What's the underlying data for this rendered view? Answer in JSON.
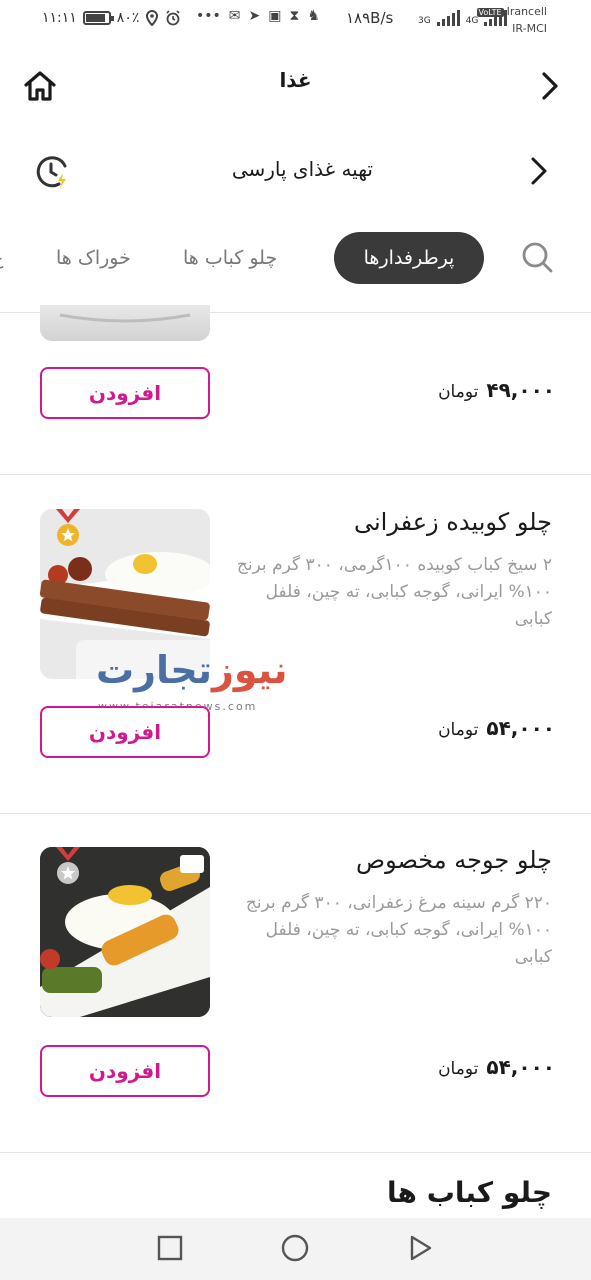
{
  "status_bar": {
    "time": "۱۱:۱۱",
    "battery": "۸۰٪",
    "network_speed": "۱۸۹B/s",
    "carrier_1": "Irancell",
    "carrier_2": "IR-MCI",
    "volte_label": "VoLTE",
    "net_3g": "3G",
    "net_4g": "4G"
  },
  "header": {
    "title": "غذا",
    "home_icon": "home-icon",
    "back_icon": "chevron-right-icon"
  },
  "restaurant": {
    "name": "تهیه غذای پارسی"
  },
  "tabs": [
    {
      "label": "پرطرفدارها",
      "active": true
    },
    {
      "label": "چلو کباب ها",
      "active": false
    },
    {
      "label": "خوراک ها",
      "active": false
    },
    {
      "label": "غ",
      "active": false
    }
  ],
  "products": [
    {
      "price": "۴۹,۰۰۰",
      "currency": "تومان",
      "add_label": "افزودن"
    },
    {
      "name": "چلو کوبیده زعفرانی",
      "description": "۲ سیخ کباب کوبیده ۱۰۰گرمی، ۳۰۰ گرم برنج ۱۰۰% ایرانی، گوجه کبابی، ته چین، فلفل کبابی",
      "price": "۵۴,۰۰۰",
      "currency": "تومان",
      "add_label": "افزودن"
    },
    {
      "name": "چلو جوجه مخصوص",
      "description": "۲۲۰ گرم سینه مرغ زعفرانی، ۳۰۰ گرم برنج ۱۰۰% ایرانی، گوجه کبابی، ته چین، فلفل کبابی",
      "price": "۵۴,۰۰۰",
      "currency": "تومان",
      "add_label": "افزودن"
    }
  ],
  "section_heading": "چلو کباب ها",
  "watermark": {
    "text_a": "تجارت",
    "text_b": "نیوز",
    "url": "www.tejaratnews.com"
  },
  "colors": {
    "accent": "#d1188f",
    "tab_active_bg": "#3a3a3a"
  }
}
